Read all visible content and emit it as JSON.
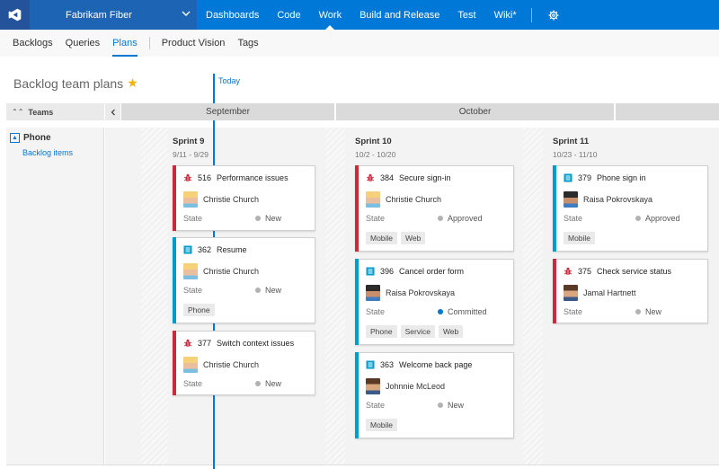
{
  "topbar": {
    "project": "Fabrikam Fiber",
    "nav": [
      "Dashboards",
      "Code",
      "Work",
      "Build and Release",
      "Test",
      "Wiki*"
    ],
    "active": "Work"
  },
  "subnav": {
    "items": [
      "Backlogs",
      "Queries",
      "Plans",
      "Product Vision",
      "Tags"
    ],
    "active": "Plans"
  },
  "page": {
    "title": "Backlog team plans",
    "today_label": "Today",
    "teams_label": "Teams",
    "months": [
      "September",
      "October"
    ]
  },
  "team": {
    "name": "Phone",
    "link": "Backlog items"
  },
  "state_label": "State",
  "sprints": [
    {
      "name": "Sprint 9",
      "dates": "9/11 - 9/29"
    },
    {
      "name": "Sprint 10",
      "dates": "10/2 - 10/20"
    },
    {
      "name": "Sprint 11",
      "dates": "10/23 - 11/10"
    }
  ],
  "cards": [
    {
      "id": "516",
      "title": "Performance issues",
      "type": "bug",
      "assignee": "Christie Church",
      "avatar": "blond",
      "state": "New",
      "state_color": "#b2b2b2",
      "tags": []
    },
    {
      "id": "362",
      "title": "Resume",
      "type": "story",
      "assignee": "Christie Church",
      "avatar": "blond",
      "state": "New",
      "state_color": "#b2b2b2",
      "tags": [
        "Phone"
      ]
    },
    {
      "id": "377",
      "title": "Switch context issues",
      "type": "bug",
      "assignee": "Christie Church",
      "avatar": "blond",
      "state": "New",
      "state_color": "#b2b2b2",
      "tags": []
    },
    {
      "id": "384",
      "title": "Secure sign-in",
      "type": "bug",
      "assignee": "Christie Church",
      "avatar": "blond",
      "state": "Approved",
      "state_color": "#b2b2b2",
      "tags": [
        "Mobile",
        "Web"
      ]
    },
    {
      "id": "396",
      "title": "Cancel order form",
      "type": "story",
      "assignee": "Raisa Pokrovskaya",
      "avatar": "dark",
      "state": "Committed",
      "state_color": "#007acc",
      "tags": [
        "Phone",
        "Service",
        "Web"
      ]
    },
    {
      "id": "363",
      "title": "Welcome back page",
      "type": "story",
      "assignee": "Johnnie McLeod",
      "avatar": "male",
      "state": "New",
      "state_color": "#b2b2b2",
      "tags": [
        "Mobile"
      ]
    },
    {
      "id": "379",
      "title": "Phone sign in",
      "type": "story",
      "assignee": "Raisa Pokrovskaya",
      "avatar": "dark",
      "state": "Approved",
      "state_color": "#b2b2b2",
      "tags": [
        "Mobile"
      ]
    },
    {
      "id": "375",
      "title": "Check service status",
      "type": "bug",
      "assignee": "Jamal Hartnett",
      "avatar": "male",
      "state": "New",
      "state_color": "#b2b2b2",
      "tags": []
    }
  ],
  "colors": {
    "accent": "#0078d7",
    "bug": "#cc293d",
    "story": "#009ccc"
  }
}
